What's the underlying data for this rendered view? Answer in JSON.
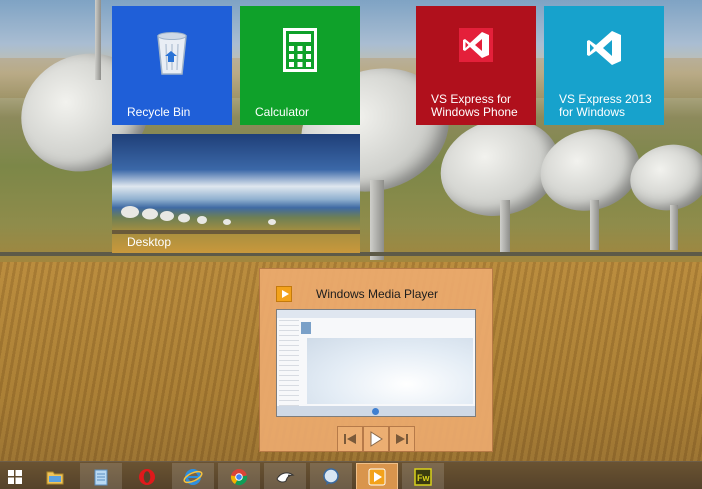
{
  "desktop": {
    "tiles": [
      {
        "id": "recycle-bin",
        "label": "Recycle Bin",
        "color": "#1f5fd8"
      },
      {
        "id": "calculator",
        "label": "Calculator",
        "color": "#0fa12a"
      },
      {
        "id": "vs-phone",
        "label": "VS Express for\nWindows Phone",
        "color": "#b0101c"
      },
      {
        "id": "vs-windows",
        "label": "VS Express 2013\nfor Windows",
        "color": "#17a2cc"
      },
      {
        "id": "desktop",
        "label": "Desktop"
      }
    ]
  },
  "preview": {
    "title": "Windows Media Player",
    "icon": "windows-media-player-icon",
    "controls": [
      "previous-track-icon",
      "play-icon",
      "next-track-icon"
    ]
  },
  "taskbar": {
    "items": [
      {
        "id": "start",
        "icon": "windows-start-icon"
      },
      {
        "id": "file-explorer",
        "icon": "folder-icon"
      },
      {
        "id": "notepad",
        "icon": "notepad-icon"
      },
      {
        "id": "opera",
        "icon": "opera-icon"
      },
      {
        "id": "internet-explorer",
        "icon": "ie-icon"
      },
      {
        "id": "chrome",
        "icon": "chrome-icon"
      },
      {
        "id": "app-bird",
        "icon": "bird-app-icon"
      },
      {
        "id": "messenger",
        "icon": "chat-icon"
      },
      {
        "id": "windows-media-player",
        "icon": "windows-media-player-icon",
        "selected": true
      },
      {
        "id": "fireworks",
        "icon": "fireworks-icon",
        "label": "Fw"
      }
    ]
  },
  "colors": {
    "accent_preview": "#ecaa6e",
    "taskbar": "#5e4a2e"
  }
}
